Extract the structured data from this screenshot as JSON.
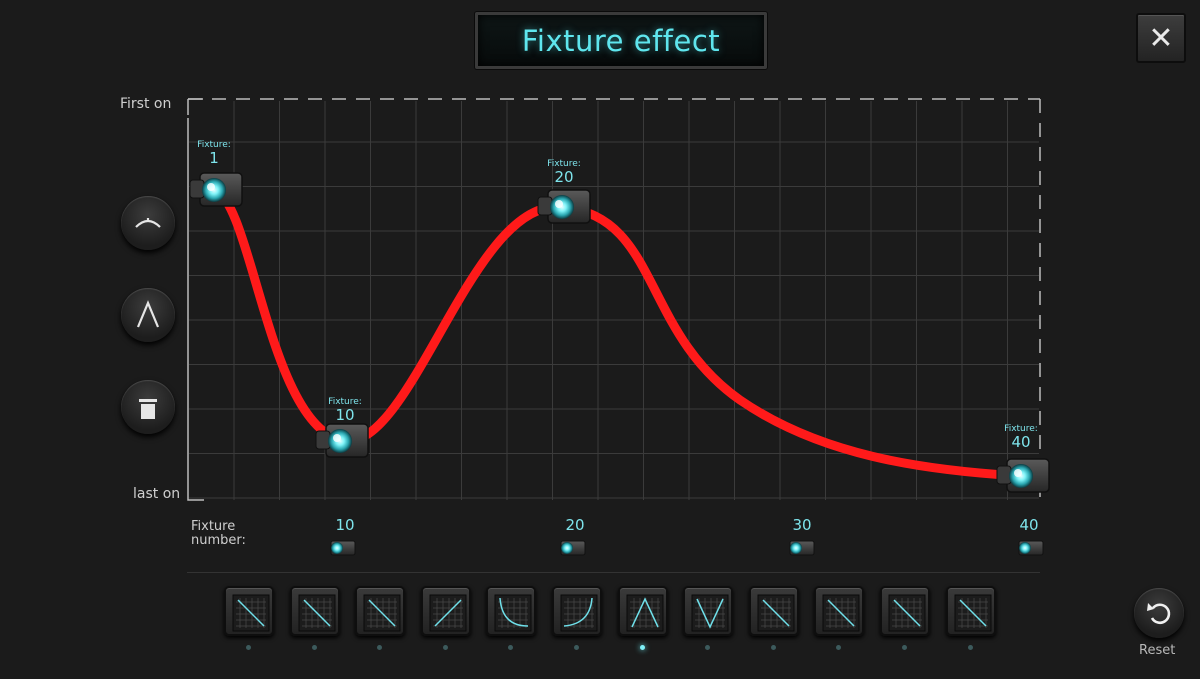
{
  "header": {
    "title": "Fixture effect",
    "close_icon": "close-icon"
  },
  "graph": {
    "y_top_label": "First on",
    "y_bottom_label": "last on",
    "curve_color": "#ff2020",
    "accent_color": "#5fe6ee",
    "control_points": [
      {
        "key": "Fixture:",
        "fixture": "1"
      },
      {
        "key": "Fixture:",
        "fixture": "10"
      },
      {
        "key": "Fixture:",
        "fixture": "20"
      },
      {
        "key": "Fixture:",
        "fixture": "40"
      }
    ]
  },
  "side_buttons": [
    {
      "icon": "arc-curve-icon"
    },
    {
      "icon": "peak-curve-icon"
    },
    {
      "icon": "flat-level-icon"
    }
  ],
  "axis": {
    "label": "Fixture\nnumber:",
    "ticks": [
      "10",
      "20",
      "30",
      "40"
    ]
  },
  "presets": [
    {
      "icon": "diagonal-down-icon",
      "selected": false
    },
    {
      "icon": "diagonal-down-icon",
      "selected": false
    },
    {
      "icon": "diagonal-down-icon",
      "selected": false
    },
    {
      "icon": "diagonal-up-icon",
      "selected": false
    },
    {
      "icon": "ease-out-icon",
      "selected": false
    },
    {
      "icon": "ease-in-icon",
      "selected": false
    },
    {
      "icon": "peak-icon",
      "selected": true
    },
    {
      "icon": "valley-icon",
      "selected": false
    },
    {
      "icon": "diagonal-down-icon",
      "selected": false
    },
    {
      "icon": "diagonal-down-icon",
      "selected": false
    },
    {
      "icon": "diagonal-down-icon",
      "selected": false
    },
    {
      "icon": "diagonal-down-icon",
      "selected": false
    }
  ],
  "reset": {
    "label": "Reset",
    "icon": "undo-icon"
  }
}
